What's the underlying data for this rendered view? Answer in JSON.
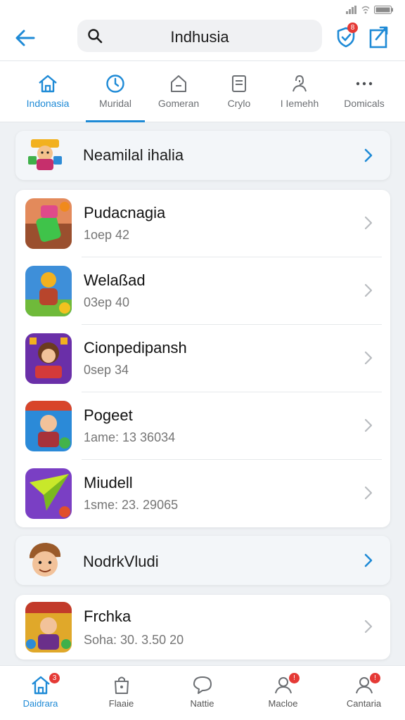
{
  "search": {
    "text": "Indhusia"
  },
  "header": {
    "notification_badge": "8"
  },
  "tabs": [
    {
      "label": "Indonasia",
      "icon": "home-icon",
      "active": true
    },
    {
      "label": "Muridal",
      "icon": "clock-icon",
      "active": false
    },
    {
      "label": "Gomeran",
      "icon": "house-outline-icon",
      "active": false
    },
    {
      "label": "Crylo",
      "icon": "document-icon",
      "active": false
    },
    {
      "label": "I Iemehh",
      "icon": "person-outline-icon",
      "active": false
    },
    {
      "label": "Domicals",
      "icon": "more-icon",
      "active": false
    }
  ],
  "featured_top": {
    "label": "Neamilal ihalia"
  },
  "apps": [
    {
      "title": "Pudacnagia",
      "subtitle": "1oep 42"
    },
    {
      "title": "Welaßad",
      "subtitle": "03ep 40"
    },
    {
      "title": "Cionpedipansh",
      "subtitle": "0sep 34"
    },
    {
      "title": "Pogeet",
      "subtitle": "1ame: 13  36034"
    },
    {
      "title": "Miudell",
      "subtitle": "1sme: 23. 29065"
    }
  ],
  "featured_bottom": {
    "label": "NodrkVludi"
  },
  "last_app": {
    "title": "Frchka",
    "subtitle": "Soha: 30. 3.50 20"
  },
  "bottom_nav": [
    {
      "label": "Daidrara",
      "icon": "home-icon",
      "badge": "3",
      "active": true
    },
    {
      "label": "Flaaie",
      "icon": "bag-icon",
      "badge": "",
      "active": false
    },
    {
      "label": "Nattie",
      "icon": "chat-bubble-icon",
      "badge": "",
      "active": false
    },
    {
      "label": "Macloe",
      "icon": "profile-icon",
      "badge": "!",
      "active": false
    },
    {
      "label": "Cantaria",
      "icon": "profile-icon",
      "badge": "!",
      "active": false
    }
  ],
  "colors": {
    "accent": "#1e8ad6",
    "badge": "#e53935"
  }
}
